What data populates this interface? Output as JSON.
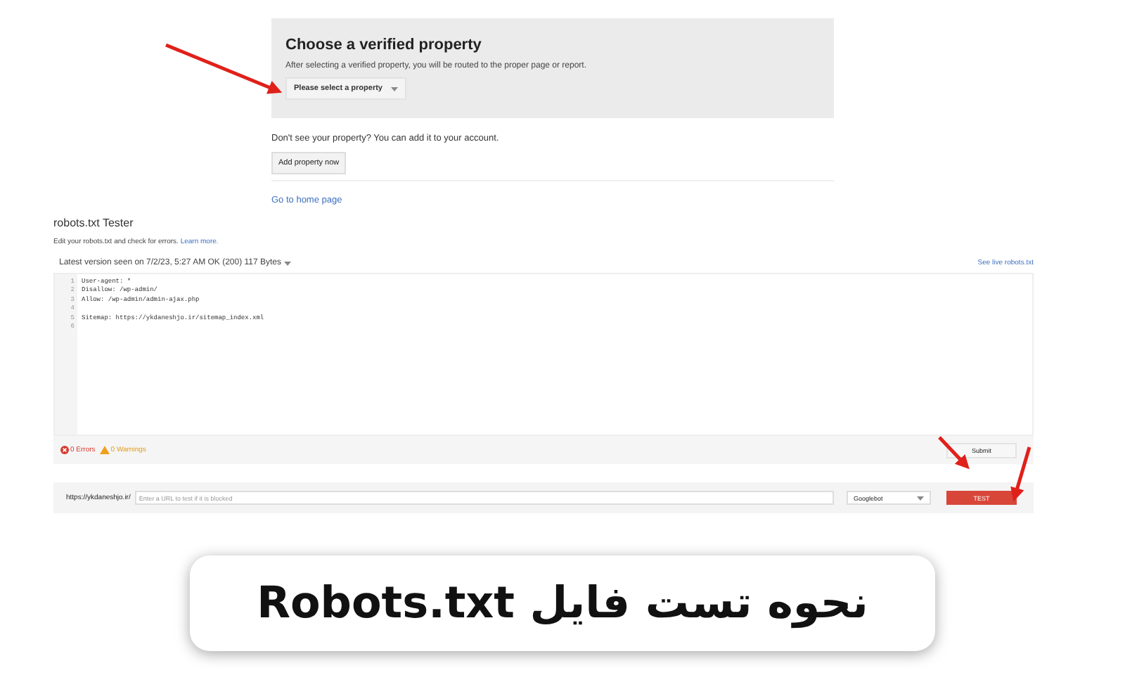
{
  "property_panel": {
    "title": "Choose a verified property",
    "description": "After selecting a verified property, you will be routed to the proper page or report.",
    "dropdown": {
      "label": "Please select a property"
    }
  },
  "add_prompt": "Don't see your property? You can add it to your account.",
  "add_button": "Add property now",
  "home_link": "Go to home page",
  "tester": {
    "title": "robots.txt Tester",
    "description": "Edit your robots.txt and check for errors.",
    "learn_more": "Learn more.",
    "version_text": "Latest version seen on 7/2/23, 5:27 AM OK (200) 117 Bytes",
    "live_link": "See live robots.txt",
    "code_lines": [
      {
        "number": "1",
        "text": "User-agent: *"
      },
      {
        "number": "2",
        "text": "Disallow: /wp-admin/"
      },
      {
        "number": "3",
        "text": "Allow: /wp-admin/admin-ajax.php"
      },
      {
        "number": "4"
      },
      {
        "number": "5",
        "text": "Sitemap: https://ykdaneshjo.ir/sitemap_index.xml"
      },
      {
        "number": "6"
      }
    ],
    "errors": "0 Errors",
    "warnings": "0 Warnings",
    "submit_button": "Submit",
    "url_prefix": "https://ykdaneshjo.ir/",
    "url_placeholder": "Enter a URL to test if it is blocked",
    "agent_select": "Googlebot",
    "test_button": "TEST"
  },
  "banner": {
    "title": "نحوه تست فایل Robots.txt"
  }
}
